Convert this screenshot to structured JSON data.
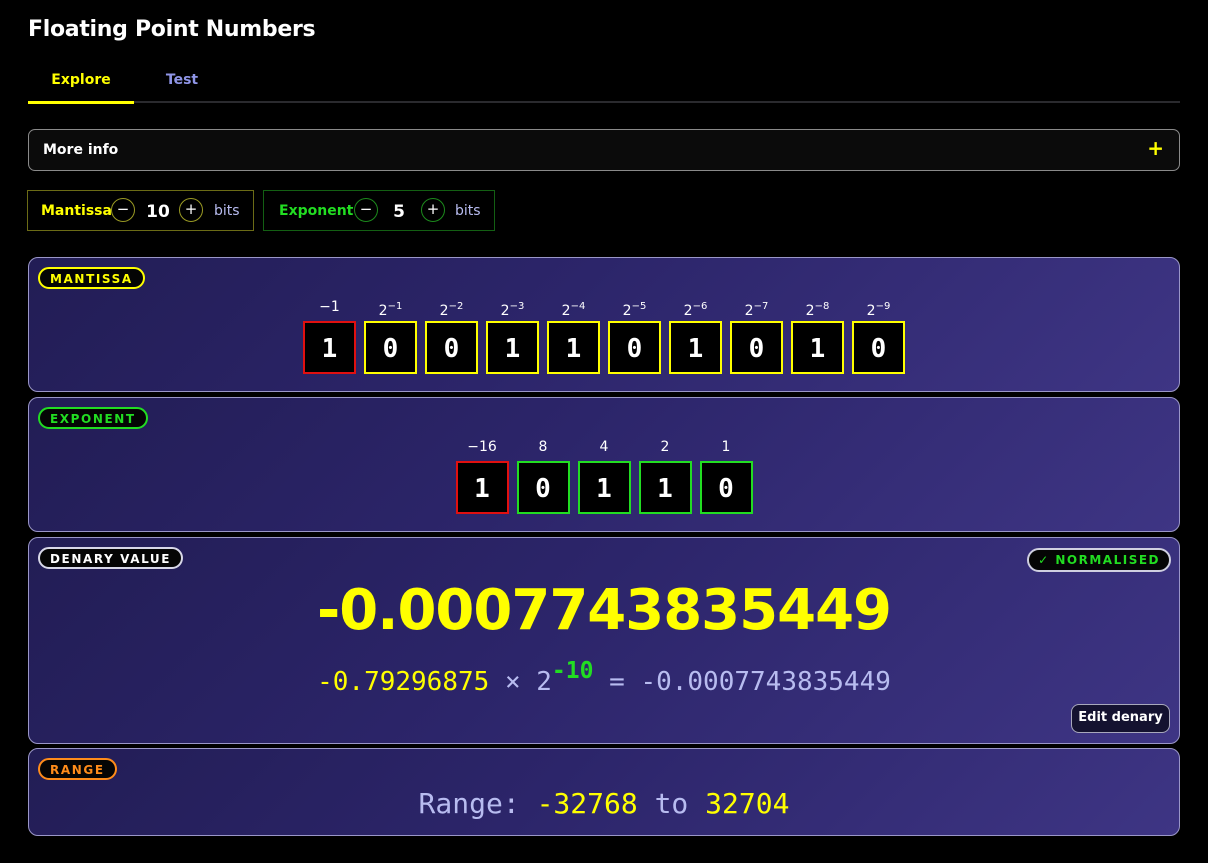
{
  "app": {
    "title": "Floating Point Numbers"
  },
  "tabs": [
    {
      "label": "Explore",
      "active": true
    },
    {
      "label": "Test",
      "active": false
    }
  ],
  "more_info": {
    "label": "More info",
    "toggle_icon": "+"
  },
  "controls": {
    "mantissa": {
      "label": "Mantissa",
      "minus": "−",
      "plus": "+",
      "value": "10",
      "unit": "bits"
    },
    "exponent": {
      "label": "Exponent",
      "minus": "−",
      "plus": "+",
      "value": "5",
      "unit": "bits"
    }
  },
  "mantissa": {
    "label": "MANTISSA",
    "bits": [
      {
        "base": "−1",
        "exp": "",
        "value": "1",
        "sign": true
      },
      {
        "base": "2",
        "exp": "−1",
        "value": "0"
      },
      {
        "base": "2",
        "exp": "−2",
        "value": "0"
      },
      {
        "base": "2",
        "exp": "−3",
        "value": "1"
      },
      {
        "base": "2",
        "exp": "−4",
        "value": "1"
      },
      {
        "base": "2",
        "exp": "−5",
        "value": "0"
      },
      {
        "base": "2",
        "exp": "−6",
        "value": "1"
      },
      {
        "base": "2",
        "exp": "−7",
        "value": "0"
      },
      {
        "base": "2",
        "exp": "−8",
        "value": "1"
      },
      {
        "base": "2",
        "exp": "−9",
        "value": "0"
      }
    ]
  },
  "exponent": {
    "label": "EXPONENT",
    "bits": [
      {
        "base": "−16",
        "exp": "",
        "value": "1",
        "sign": true
      },
      {
        "base": "8",
        "exp": "",
        "value": "0"
      },
      {
        "base": "4",
        "exp": "",
        "value": "1"
      },
      {
        "base": "2",
        "exp": "",
        "value": "1"
      },
      {
        "base": "1",
        "exp": "",
        "value": "0"
      }
    ]
  },
  "denary": {
    "label": "DENARY VALUE",
    "badge": "✓ NORMALISED",
    "value": "-0.0007743835449",
    "formula": {
      "mantissa": "-0.79296875",
      "times": "×",
      "base": "2",
      "exponent": "-10",
      "equals": "=",
      "result": "-0.0007743835449"
    },
    "edit_button": "Edit denary"
  },
  "range": {
    "label": "RANGE",
    "prefix": "Range:",
    "min": "-32768",
    "to": "to",
    "max": "32704"
  },
  "colors": {
    "accent_yellow": "#ffff00",
    "accent_green": "#22dd22",
    "sign_red": "#e01010",
    "range_orange": "#ff8c1a",
    "tab_inactive": "#8f95e6",
    "panel_bg": "#2c256a"
  }
}
